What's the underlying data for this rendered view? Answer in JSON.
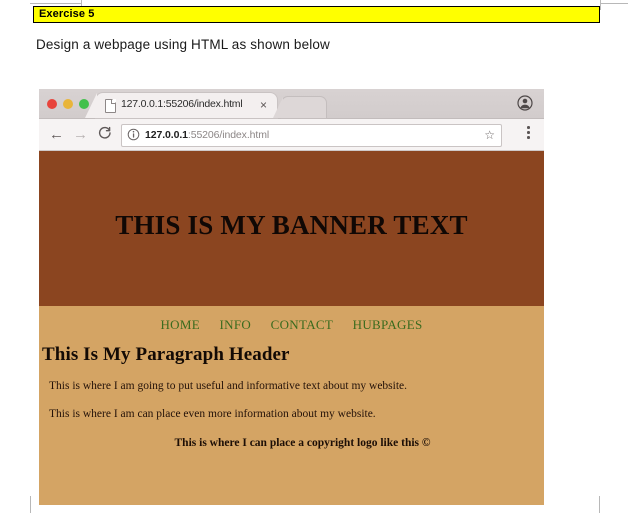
{
  "document": {
    "exercise_label": "Exercise 5",
    "instruction": "Design a webpage using HTML as shown below",
    "highlight_color": "#ffff00"
  },
  "browser": {
    "tab": {
      "title": "127.0.0.1:55206/index.html",
      "close_glyph": "×",
      "favicon_name": "page-icon"
    },
    "toolbar": {
      "back_glyph": "←",
      "forward_glyph": "→",
      "reload_glyph": "↻",
      "url_host": "127.0.0.1",
      "url_rest": ":55206/index.html",
      "star_glyph": "☆",
      "info_icon": "info-circle-icon",
      "menu_icon": "three-dot-menu-icon",
      "profile_icon": "profile-avatar-icon"
    },
    "window_controls": {
      "close_color": "#e8443c",
      "minimize_color": "#e9b53a",
      "maximize_color": "#41c04b"
    }
  },
  "webpage": {
    "banner_text": "THIS IS MY BANNER TEXT",
    "banner_color": "#8b4520",
    "body_color": "#d4a464",
    "nav_color": "#3a6b1e",
    "nav": [
      {
        "label": "HOME"
      },
      {
        "label": "INFO"
      },
      {
        "label": "CONTACT"
      },
      {
        "label": "HUBPAGES"
      }
    ],
    "heading": "This Is My Paragraph Header",
    "paragraph_1": "This is where I am going to put useful and informative text about my website.",
    "paragraph_2": "This is where I am can place even more information about my website.",
    "copyright_line": "This is where I can place a copyright logo like this ©"
  }
}
